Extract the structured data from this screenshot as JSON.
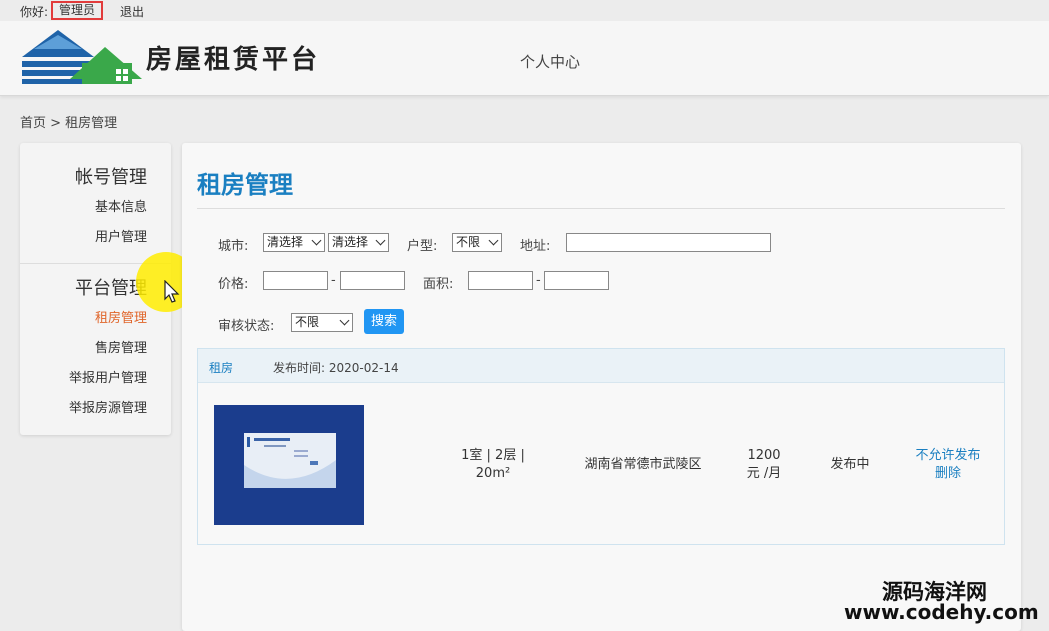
{
  "topbar": {
    "greeting": "你好:",
    "user": "管理员",
    "logout": "退出"
  },
  "header": {
    "site_title": "房屋租赁平台",
    "nav_center": "个人中心"
  },
  "breadcrumb": "首页 > 租房管理",
  "sidebar": {
    "group1": "帐号管理",
    "group1_items": [
      "基本信息",
      "用户管理"
    ],
    "group2": "平台管理",
    "group2_items": [
      "租房管理",
      "售房管理",
      "举报用户管理",
      "举报房源管理"
    ],
    "active": "租房管理"
  },
  "main": {
    "title": "租房管理",
    "filters": {
      "city_label": "城市:",
      "city_select1": "清选择",
      "city_select2": "清选择",
      "layout_label": "户型:",
      "layout_value": "不限",
      "address_label": "地址:",
      "address_value": "",
      "price_label": "价格:",
      "price_from": "",
      "price_to": "",
      "dash": "-",
      "area_label": "面积:",
      "area_from": "",
      "area_to": "",
      "status_label": "审核状态:",
      "status_value": "不限",
      "search_button": "搜索"
    },
    "listing": {
      "type": "租房",
      "publish_label": "发布时间:",
      "publish_date": "2020-02-14",
      "layout_line1": "1室 | 2层 |",
      "layout_line2": "20m²",
      "address": "湖南省常德市武陵区",
      "price_line1": "1200",
      "price_line2": "元 /月",
      "status": "发布中",
      "action_disallow": "不允许发布",
      "action_delete": "删除"
    }
  },
  "watermark": {
    "line1": "源码海洋网",
    "line2": "www.codehy.com"
  },
  "colors": {
    "accent": "#1a7fc1",
    "active": "#e0652a",
    "button": "#2196f3",
    "highlight": "#e23b3b"
  }
}
